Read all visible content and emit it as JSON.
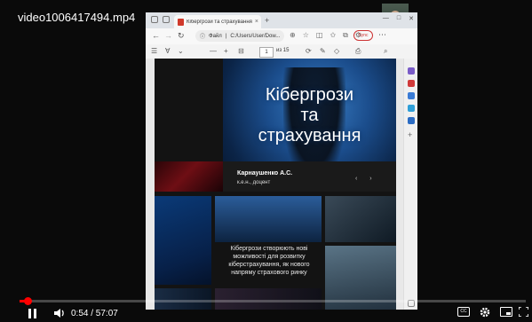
{
  "player": {
    "filename": "video1006417494.mp4",
    "time": "0:54 / 57:07",
    "progress_fraction": 0.016,
    "play_state_icon": "pause-icon",
    "controls": [
      "volume-icon",
      "captions-icon",
      "settings-icon",
      "miniplayer-icon",
      "fullscreen-icon"
    ]
  },
  "browser": {
    "tab_title": "Кібергрози та страхування",
    "tab_close": "×",
    "new_tab": "+",
    "url_scheme": "Файл",
    "url_path": "C:/Users/User/Dow...",
    "sync_label": "Sync",
    "window_buttons": [
      "—",
      "□",
      "✕"
    ],
    "nav_icons": [
      "back-icon",
      "forward-icon",
      "refresh-icon"
    ]
  },
  "pdf_toolbar": {
    "page_current": "1",
    "page_total": "из 15",
    "zoom_out": "—",
    "zoom_in": "+",
    "icons": [
      "contents-icon",
      "highlight-icon",
      "zoom-out-icon",
      "zoom-in-icon",
      "fit-page-icon",
      "rotate-icon",
      "draw-icon",
      "search-icon",
      "print-icon",
      "save-icon"
    ]
  },
  "slide": {
    "title": "Кібергрози та страхування",
    "title_lines": [
      "Кібергрози",
      "та",
      "страхування"
    ],
    "author": "Карнаушенко А.С.",
    "degree": "к.е.н., доцент",
    "nav_arrows": "‹ ›",
    "tagline": "Кібергрози створюють нові можливості для розвитку кіберстрахування, як нового напряму страхового ринку"
  },
  "colors": {
    "progress": "#ff0000",
    "hero_blue": "#1b4d8c",
    "tab_pdf": "#d0392b"
  }
}
